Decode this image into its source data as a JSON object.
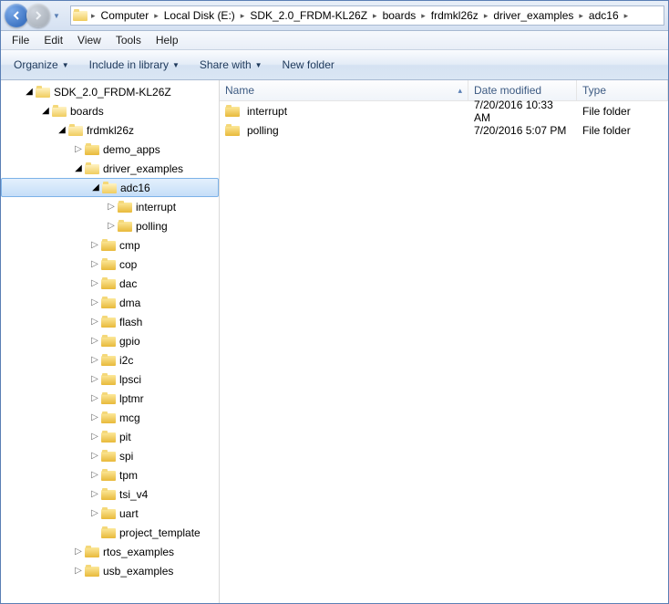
{
  "breadcrumb": [
    "Computer",
    "Local Disk (E:)",
    "SDK_2.0_FRDM-KL26Z",
    "boards",
    "frdmkl26z",
    "driver_examples",
    "adc16"
  ],
  "menu": {
    "file": "File",
    "edit": "Edit",
    "view": "View",
    "tools": "Tools",
    "help": "Help"
  },
  "toolbar": {
    "organize": "Organize",
    "include": "Include in library",
    "share": "Share with",
    "newfolder": "New folder"
  },
  "columns": {
    "name": "Name",
    "date": "Date modified",
    "type": "Type"
  },
  "tree": {
    "root": "SDK_2.0_FRDM-KL26Z",
    "boards": "boards",
    "frdm": "frdmkl26z",
    "demo_apps": "demo_apps",
    "driver_examples": "driver_examples",
    "adc16": "adc16",
    "interrupt": "interrupt",
    "polling": "polling",
    "items": [
      "cmp",
      "cop",
      "dac",
      "dma",
      "flash",
      "gpio",
      "i2c",
      "lpsci",
      "lptmr",
      "mcg",
      "pit",
      "spi",
      "tpm",
      "tsi_v4",
      "uart"
    ],
    "project_template": "project_template",
    "rtos_examples": "rtos_examples",
    "usb_examples": "usb_examples"
  },
  "files": [
    {
      "name": "interrupt",
      "date": "7/20/2016 10:33 AM",
      "type": "File folder"
    },
    {
      "name": "polling",
      "date": "7/20/2016 5:07 PM",
      "type": "File folder"
    }
  ]
}
